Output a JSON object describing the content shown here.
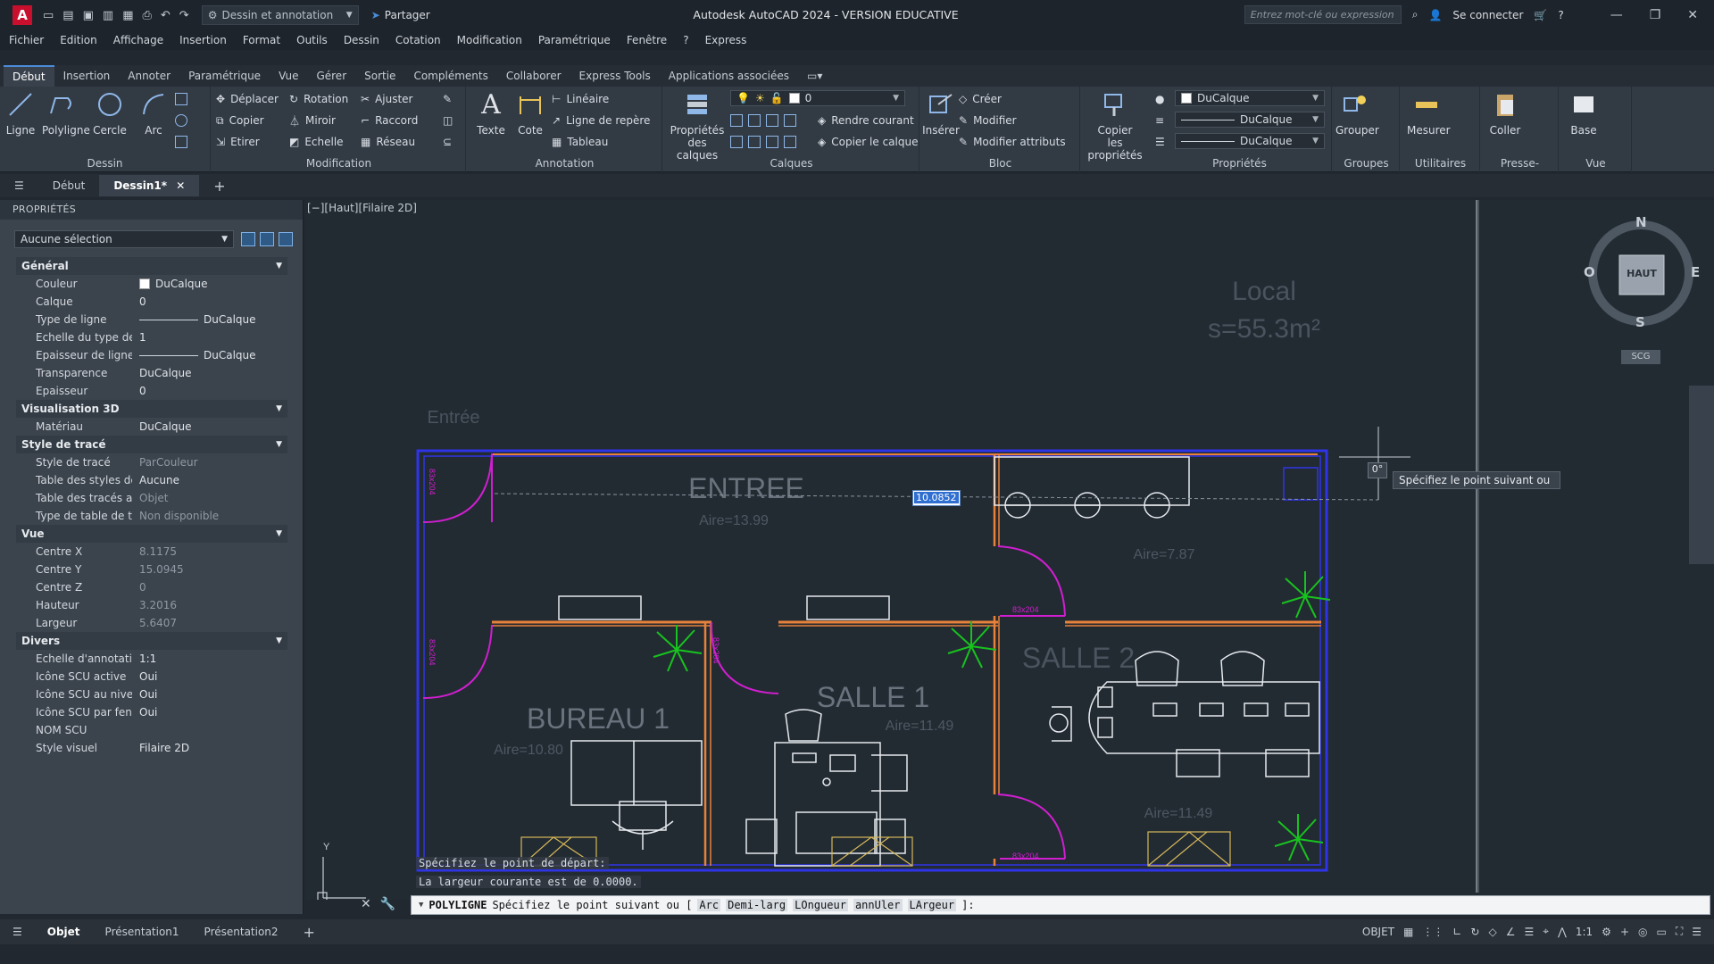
{
  "titlebar": {
    "workspace": "Dessin et annotation",
    "share": "Partager",
    "title": "Autodesk AutoCAD 2024 - VERSION EDUCATIVE",
    "search_placeholder": "Entrez mot-clé ou expression",
    "connect": "Se connecter"
  },
  "menu": [
    "Fichier",
    "Edition",
    "Affichage",
    "Insertion",
    "Format",
    "Outils",
    "Dessin",
    "Cotation",
    "Modification",
    "Paramétrique",
    "Fenêtre",
    "?",
    "Express"
  ],
  "ribbon_tabs": [
    "Début",
    "Insertion",
    "Annoter",
    "Paramétrique",
    "Vue",
    "Gérer",
    "Sortie",
    "Compléments",
    "Collaborer",
    "Express Tools",
    "Applications associées"
  ],
  "ribbon": {
    "dessin": {
      "title": "Dessin",
      "ligne": "Ligne",
      "polyligne": "Polyligne",
      "cercle": "Cercle",
      "arc": "Arc"
    },
    "modification": {
      "title": "Modification",
      "deplacer": "Déplacer",
      "rotation": "Rotation",
      "ajuster": "Ajuster",
      "copier": "Copier",
      "miroir": "Miroir",
      "raccord": "Raccord",
      "etirer": "Etirer",
      "echelle": "Echelle",
      "reseau": "Réseau"
    },
    "annotation": {
      "title": "Annotation",
      "texte": "Texte",
      "cote": "Cote",
      "lineaire": "Linéaire",
      "ligne_repere": "Ligne de repère",
      "tableau": "Tableau"
    },
    "calques": {
      "title": "Calques",
      "proprietes_1": "Propriétés",
      "proprietes_2": "des calques",
      "current": "0",
      "rendre_courant": "Rendre courant",
      "copier_calque": "Copier le calque"
    },
    "bloc": {
      "title": "Bloc",
      "inserer": "Insérer",
      "creer": "Créer",
      "modifier": "Modifier",
      "modifier_attributs": "Modifier attributs"
    },
    "copier_props_1": "Copier",
    "copier_props_2": "les propriétés",
    "proprietes": {
      "title": "Propriétés",
      "color": "DuCalque",
      "linetype": "DuCalque",
      "lineweight": "DuCalque"
    },
    "groupes": {
      "title": "Groupes",
      "grouper": "Grouper"
    },
    "utilitaires": {
      "title": "Utilitaires",
      "mesurer": "Mesurer"
    },
    "presse": {
      "title": "Presse-papiers",
      "coller": "Coller"
    },
    "vue": {
      "title": "Vue",
      "base": "Base"
    }
  },
  "filetabs": {
    "debut": "Début",
    "dessin1": "Dessin1*"
  },
  "properties": {
    "header": "PROPRIÉTÉS",
    "selection": "Aucune sélection",
    "categories": [
      {
        "name": "Général",
        "rows": [
          {
            "k": "Couleur",
            "v": "DuCalque"
          },
          {
            "k": "Calque",
            "v": "0"
          },
          {
            "k": "Type de ligne",
            "v": "DuCalque"
          },
          {
            "k": "Echelle du type de li...",
            "v": "1"
          },
          {
            "k": "Epaisseur de ligne",
            "v": "DuCalque"
          },
          {
            "k": "Transparence",
            "v": "DuCalque"
          },
          {
            "k": "Epaisseur",
            "v": "0"
          }
        ]
      },
      {
        "name": "Visualisation 3D",
        "rows": [
          {
            "k": "Matériau",
            "v": "DuCalque"
          }
        ]
      },
      {
        "name": "Style de tracé",
        "rows": [
          {
            "k": "Style de tracé",
            "v": "ParCouleur"
          },
          {
            "k": "Table des styles de tr...",
            "v": "Aucune"
          },
          {
            "k": "Table des tracés atta...",
            "v": "Objet"
          },
          {
            "k": "Type de table de tracé",
            "v": "Non disponible"
          }
        ]
      },
      {
        "name": "Vue",
        "rows": [
          {
            "k": "Centre X",
            "v": "8.1175"
          },
          {
            "k": "Centre Y",
            "v": "15.0945"
          },
          {
            "k": "Centre Z",
            "v": "0"
          },
          {
            "k": "Hauteur",
            "v": "3.2016"
          },
          {
            "k": "Largeur",
            "v": "5.6407"
          }
        ]
      },
      {
        "name": "Divers",
        "rows": [
          {
            "k": "Echelle d'annotation",
            "v": "1:1"
          },
          {
            "k": "Icône SCU active",
            "v": "Oui"
          },
          {
            "k": "Icône SCU au niveau...",
            "v": "Oui"
          },
          {
            "k": "Icône SCU par fenêtre",
            "v": "Oui"
          },
          {
            "k": "NOM SCU",
            "v": ""
          },
          {
            "k": "Style visuel",
            "v": "Filaire 2D"
          }
        ]
      }
    ]
  },
  "viewport": {
    "label": "[−][Haut][Filaire 2D]",
    "rooms": {
      "entree": "ENTREE",
      "entree_area": "Aire=13.99",
      "bureau": "BUREAU 1",
      "bureau_area": "Aire=10.80",
      "salle1": "SALLE 1",
      "salle1_area": "Aire=11.49",
      "salle2": "SALLE 2",
      "salle2_area": "Aire=11.49",
      "local": "Local",
      "local_area": "s=55.3m²",
      "small_area": "Aire=7.87",
      "entree_ghost": "Entrée",
      "door_dim": "83x204"
    },
    "dyn_input": "10.0852",
    "angle": "0°",
    "tooltip": "Spécifiez le point suivant ou",
    "viewcube": {
      "n": "N",
      "s": "S",
      "e": "E",
      "o": "O",
      "face": "HAUT",
      "scu": "SCG"
    },
    "axis_y": "Y"
  },
  "command": {
    "history1": "Spécifiez le point de départ:",
    "history2": "La largeur courante est de 0.0000.",
    "name": "POLYLIGNE",
    "prompt": "Spécifiez le point suivant ou [",
    "options": [
      "Arc",
      "Demi-larg",
      "LOngueur",
      "annUler",
      "LArgeur"
    ],
    "end": "]:"
  },
  "layout_tabs": [
    "Objet",
    "Présentation1",
    "Présentation2"
  ],
  "status": {
    "mode": "OBJET",
    "scale": "1:1"
  },
  "colors": {
    "wall": "#2f34e6",
    "partition": "#e8823a",
    "door": "#d01fd0",
    "plant": "#18c21f",
    "ghost": "#4a545e"
  }
}
